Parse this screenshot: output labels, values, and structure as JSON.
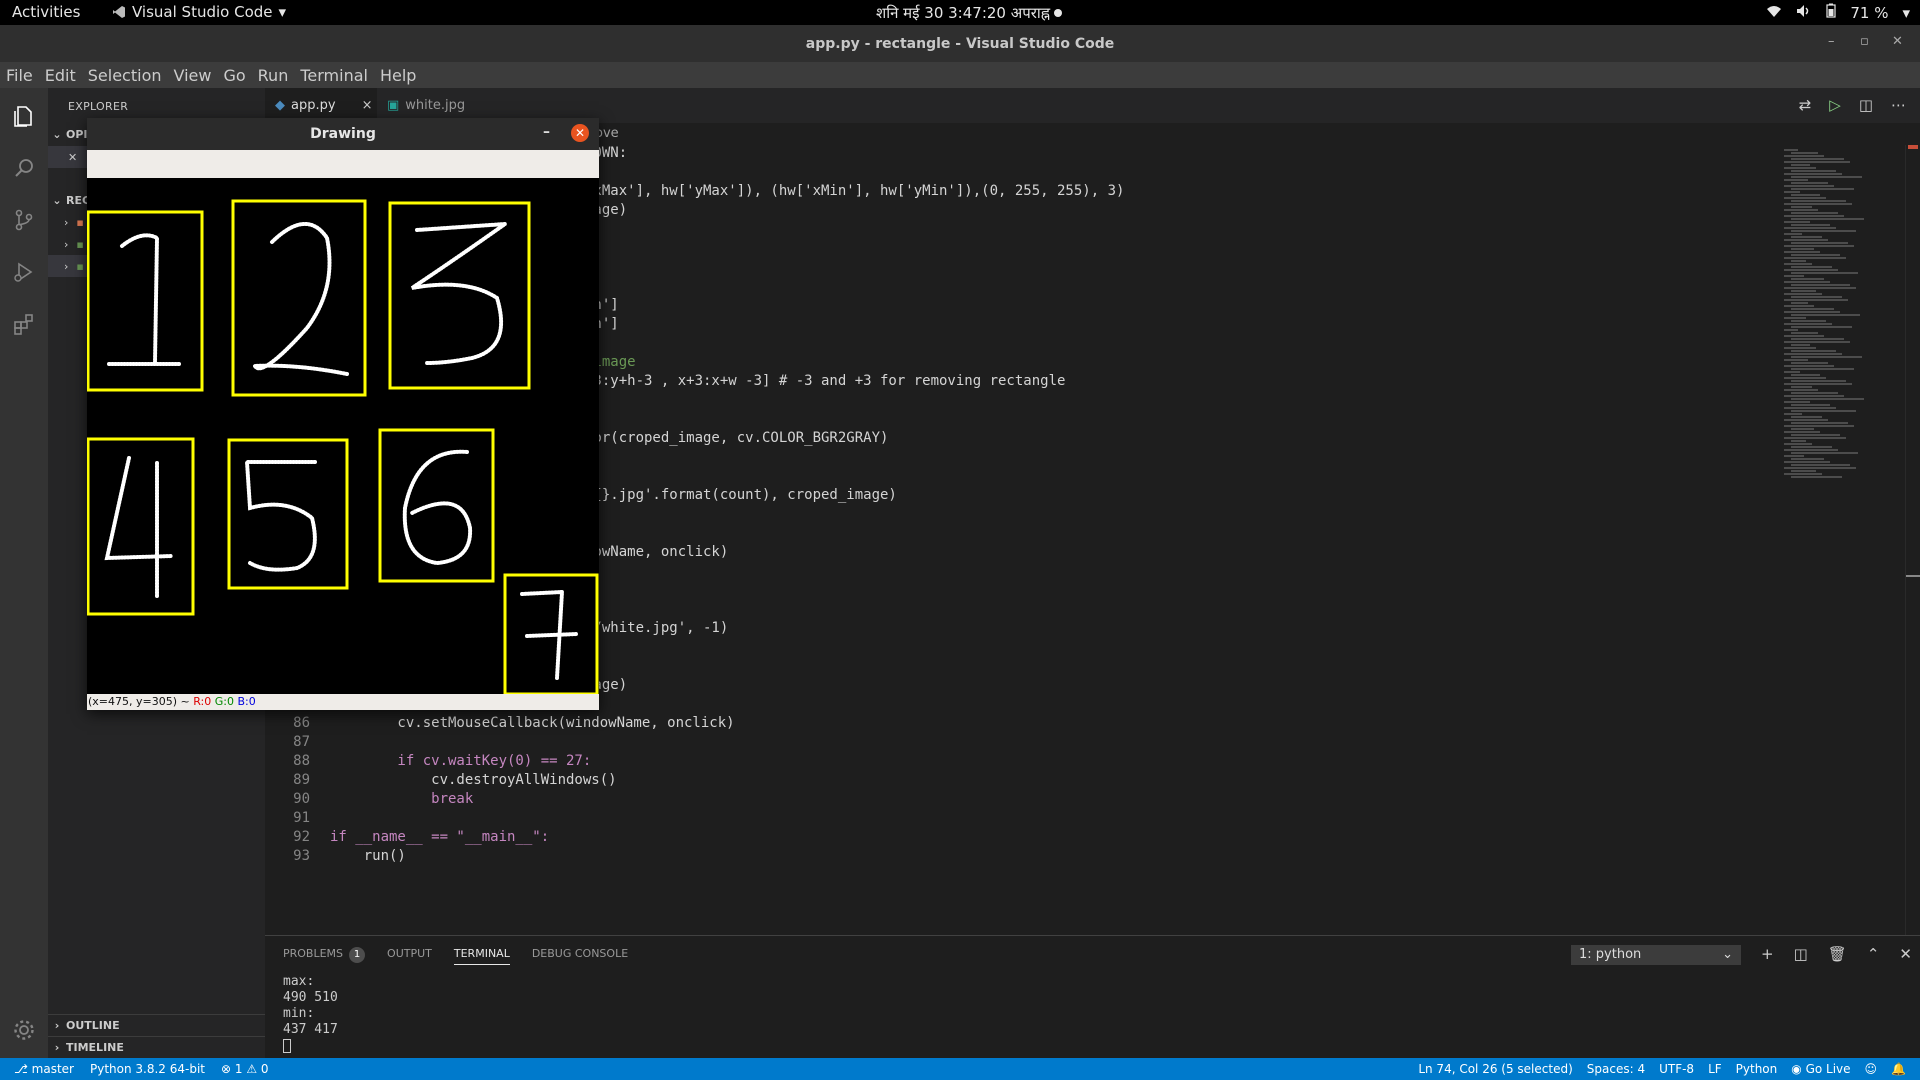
{
  "gnome": {
    "activities": "Activities",
    "app_name": "Visual Studio Code",
    "clock": "शनि मई 30   3:47:20 अपराह्न",
    "battery": "71 %"
  },
  "window": {
    "title": "app.py - rectangle - Visual Studio Code"
  },
  "menu": [
    "File",
    "Edit",
    "Selection",
    "View",
    "Go",
    "Run",
    "Terminal",
    "Help"
  ],
  "sidebar": {
    "header": "EXPLORER",
    "open_editors": "OPI",
    "recent": "REC",
    "outline": "OUTLINE",
    "timeline": "TIMELINE"
  },
  "tabs": [
    {
      "label": "app.py",
      "close": "×"
    },
    {
      "label": "white.jpg"
    }
  ],
  "breadcrumb": "ove",
  "code": [
    {
      "n": "",
      "text": "DOWN:"
    },
    {
      "n": "",
      "text": ""
    },
    {
      "n": "",
      "text": "'xMax'], hw['yMax']), (hw['xMin'], hw['yMin']),(0, 255, 255), 3)"
    },
    {
      "n": "",
      "text": "nage)"
    },
    {
      "n": "",
      "text": ""
    },
    {
      "n": "",
      "text": ""
    },
    {
      "n": "",
      "text": ""
    },
    {
      "n": "",
      "text": ""
    },
    {
      "n": "",
      "text": "in']"
    },
    {
      "n": "",
      "text": "in']"
    },
    {
      "n": "",
      "text": ""
    },
    {
      "n": "",
      "text": " image"
    },
    {
      "n": "",
      "text": "-3:y+h-3 , x+3:x+w -3] # -3 and +3 for removing rectangle"
    },
    {
      "n": "",
      "text": ""
    },
    {
      "n": "",
      "text": ""
    },
    {
      "n": "",
      "text": "lor(croped_image, cv.COLOR_BGR2GRAY)"
    },
    {
      "n": "",
      "text": ""
    },
    {
      "n": "",
      "text": ""
    },
    {
      "n": "",
      "text": "d{}.jpg'.format(count), croped_image)"
    },
    {
      "n": "",
      "text": ""
    },
    {
      "n": "",
      "text": ""
    },
    {
      "n": "",
      "text": "dowName, onclick)"
    },
    {
      "n": "",
      "text": ""
    },
    {
      "n": "",
      "text": ""
    },
    {
      "n": "",
      "text": ""
    },
    {
      "n": "",
      "text": "e/white.jpg', -1)"
    },
    {
      "n": "",
      "text": ""
    },
    {
      "n": "",
      "text": ""
    },
    {
      "n": "",
      "text": "nage)"
    },
    {
      "n": "",
      "text": ""
    },
    {
      "n": "86",
      "text": "        cv.setMouseCallback(windowName, onclick)"
    },
    {
      "n": "87",
      "text": ""
    },
    {
      "n": "88",
      "text": "        if cv.waitKey(0) == 27:"
    },
    {
      "n": "89",
      "text": "            cv.destroyAllWindows()"
    },
    {
      "n": "90",
      "text": "            break"
    },
    {
      "n": "91",
      "text": ""
    },
    {
      "n": "92",
      "text": "if __name__ == \"__main__\":"
    },
    {
      "n": "93",
      "text": "    run()"
    }
  ],
  "panel": {
    "tabs": [
      "PROBLEMS",
      "OUTPUT",
      "TERMINAL",
      "DEBUG CONSOLE"
    ],
    "problems_count": "1",
    "terminal_select": "1: python",
    "terminal_lines": [
      "max:",
      "490 510",
      "min:",
      "437 417"
    ]
  },
  "drawing": {
    "title": "Drawing",
    "status_xy": "(x=475, y=305) ~",
    "status_r": "R:0",
    "status_g": "G:0",
    "status_b": "B:0",
    "digits": [
      "1",
      "2",
      "3",
      "4",
      "5",
      "6",
      "7"
    ]
  },
  "status": {
    "branch": "master",
    "python": "Python 3.8.2 64-bit",
    "errors": "⊗ 1 ⚠ 0",
    "position": "Ln 74, Col 26 (5 selected)",
    "spaces": "Spaces: 4",
    "encoding": "UTF-8",
    "eol": "LF",
    "language": "Python",
    "golive": "Go Live"
  },
  "colors": {
    "accent": "#007acc",
    "box": "#ffff00",
    "close": "#e95420"
  }
}
